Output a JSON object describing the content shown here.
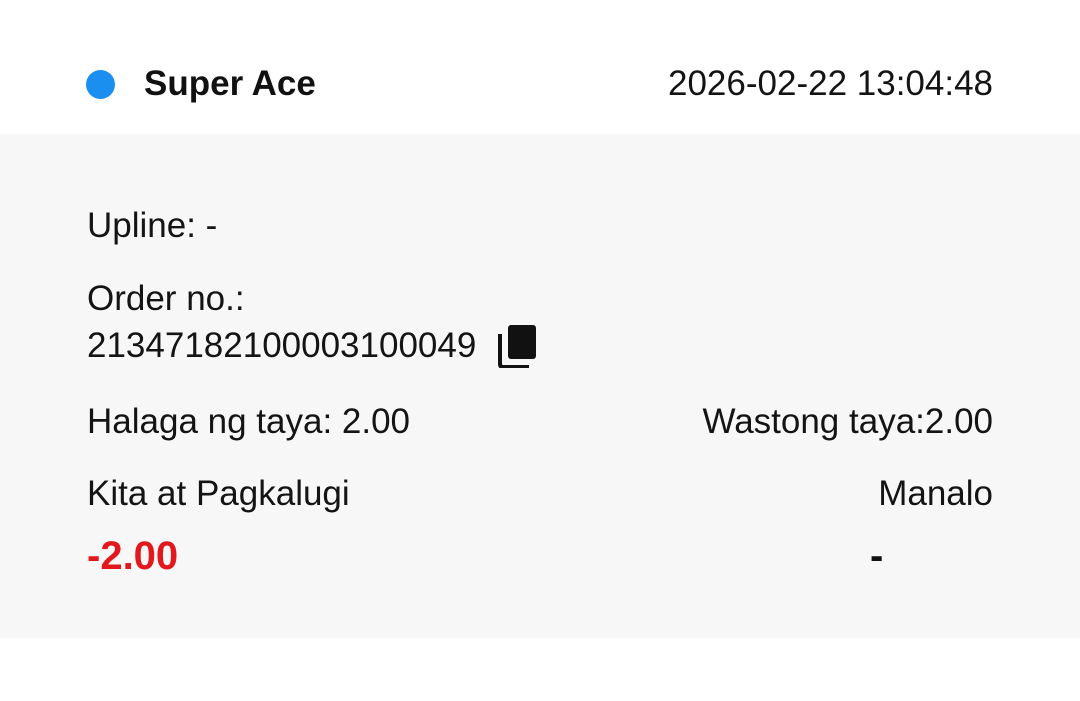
{
  "record": {
    "game_name": "Super Ace",
    "datetime": "2026-02-22 13:04:48",
    "status_color": "#1a8ff0",
    "upline": "Upline: -",
    "order_label": "Order no.:",
    "order_number": "21347182100003100049",
    "copy_icon": "copy-icon",
    "bet_amount": "Halaga ng taya: 2.00",
    "valid_bet": "Wastong taya:2.00",
    "profit_label": "Kita at Pagkalugi",
    "profit_value": "-2.00",
    "profit_color": "#e3171e",
    "win_label": "Manalo",
    "win_value": "-"
  }
}
